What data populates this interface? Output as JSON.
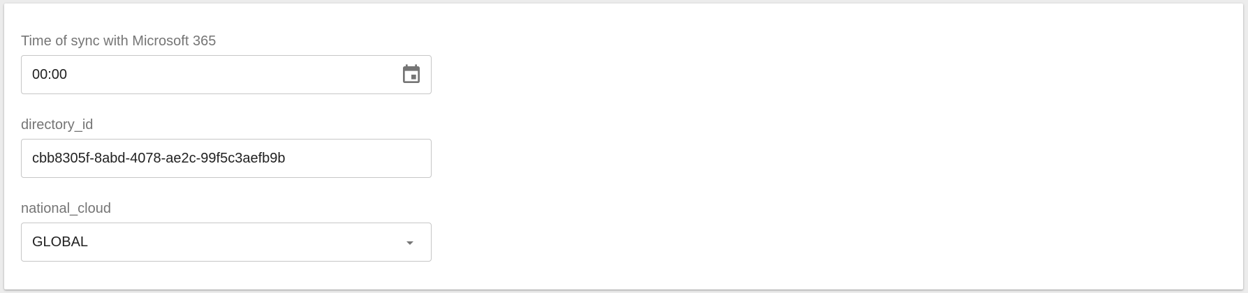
{
  "form": {
    "sync_time": {
      "label": "Time of sync with Microsoft 365",
      "value": "00:00",
      "icon": "calendar-icon"
    },
    "directory_id": {
      "label": "directory_id",
      "value": "cbb8305f-8abd-4078-ae2c-99f5c3aefb9b"
    },
    "national_cloud": {
      "label": "national_cloud",
      "value": "GLOBAL",
      "icon": "dropdown-arrow-icon"
    }
  }
}
